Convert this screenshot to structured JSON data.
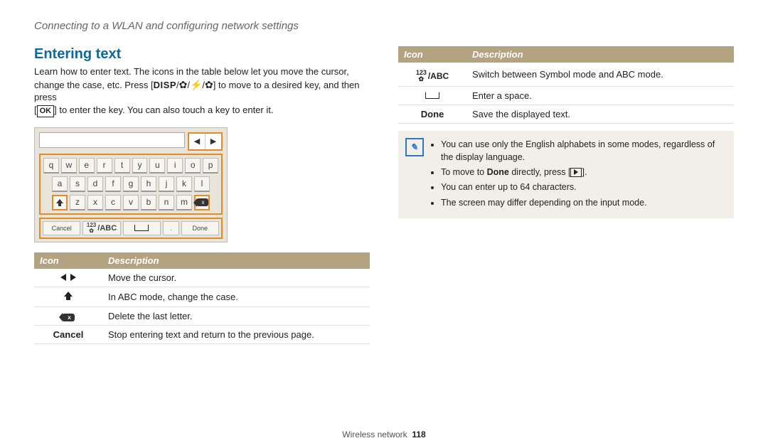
{
  "header": "Connecting to a WLAN and configuring network settings",
  "section_title": "Entering text",
  "intro": {
    "line1": "Learn how to enter text. The icons in the table below let you move the cursor,",
    "line2a": "change the case, etc. Press [",
    "line2b": "] to move to a desired key, and then press",
    "line3a": "[",
    "line3b": "] to enter the key. You can also touch a key to enter it.",
    "disp": "DISP",
    "ok": "OK"
  },
  "keyboard": {
    "row1": [
      "q",
      "w",
      "e",
      "r",
      "t",
      "y",
      "u",
      "i",
      "o",
      "p"
    ],
    "row2": [
      "a",
      "s",
      "d",
      "f",
      "g",
      "h",
      "j",
      "k",
      "l"
    ],
    "row3": [
      "z",
      "x",
      "c",
      "v",
      "b",
      "n",
      "m"
    ],
    "bottom": {
      "cancel": "Cancel",
      "mode": "/ABC",
      "mode_sup": "123",
      "dot": ".",
      "done": "Done"
    }
  },
  "table_left": {
    "h_icon": "Icon",
    "h_desc": "Description",
    "rows": [
      {
        "desc": "Move the cursor."
      },
      {
        "desc": "In ABC mode, change the case."
      },
      {
        "desc": "Delete the last letter."
      },
      {
        "icon_text": "Cancel",
        "desc": "Stop entering text and return to the previous page."
      }
    ]
  },
  "table_right": {
    "h_icon": "Icon",
    "h_desc": "Description",
    "rows": [
      {
        "icon_text": " /ABC",
        "icon_sup": "123",
        "desc": "Switch between Symbol mode and ABC mode."
      },
      {
        "desc": "Enter a space."
      },
      {
        "icon_text": "Done",
        "desc": "Save the displayed text."
      }
    ]
  },
  "note": {
    "items": [
      "You can use only the English alphabets in some modes, regardless of the display language.",
      "To move to <b>Done</b> directly, press [PLAY].",
      "You can enter up to 64 characters.",
      "The screen may differ depending on the input mode."
    ]
  },
  "footer": {
    "section": "Wireless network",
    "page": "118"
  }
}
